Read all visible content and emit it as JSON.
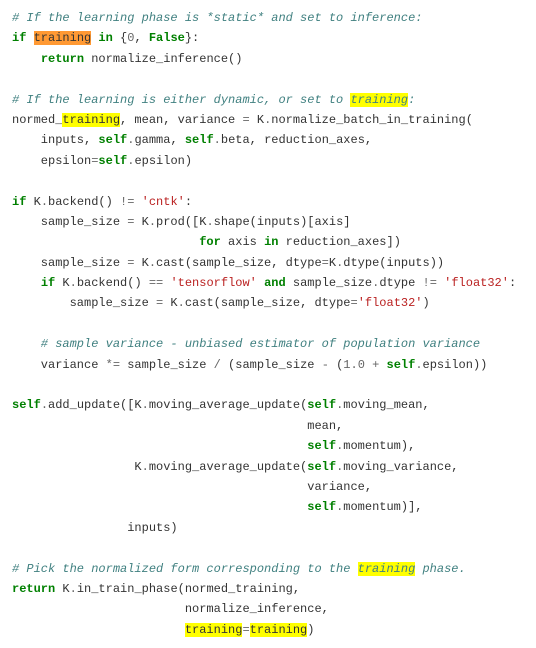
{
  "code": {
    "c1": "# If the learning phase is *static* and set to inference:",
    "l2_if": "if",
    "l2_training": "training",
    "l2_in": "in",
    "l2_brace_o": "{",
    "l2_zero": "0",
    "l2_comma": ", ",
    "l2_false": "False",
    "l2_brace_c": "}:",
    "l3_return": "return",
    "l3_normalize": " normalize_inference()",
    "c2a": "# If the learning is either dynamic, or set to ",
    "c2b": "training",
    "c2c": ":",
    "l5a": "normed_",
    "l5b": "training",
    "l5c": ", mean, variance ",
    "l5_eq": "=",
    "l5d": " K",
    "l5_dot": ".",
    "l5e": "normalize_batch_in_training(",
    "l6a": "    inputs, ",
    "l6_self1": "self",
    "l6_d1": ".",
    "l6_gamma": "gamma, ",
    "l6_self2": "self",
    "l6_d2": ".",
    "l6_beta": "beta, reduction_axes,",
    "l7_ep": "    epsilon",
    "l7_eq": "=",
    "l7_self": "self",
    "l7_d": ".",
    "l7_eps": "epsilon)",
    "l8_if": "if",
    "l8a": " K",
    "l8_d": ".",
    "l8b": "backend() ",
    "l8_ne": "!=",
    "l8_sp": " ",
    "l8_cntk": "'cntk'",
    "l8_col": ":",
    "l9a": "    sample_size ",
    "l9_eq": "=",
    "l9b": " K",
    "l9_d1": ".",
    "l9c": "prod([K",
    "l9_d2": ".",
    "l9d": "shape(inputs)[axis]",
    "l10_sp": "                          ",
    "l10_for": "for",
    "l10a": " axis ",
    "l10_in": "in",
    "l10b": " reduction_axes])",
    "l11a": "    sample_size ",
    "l11_eq": "=",
    "l11b": " K",
    "l11_d1": ".",
    "l11c": "cast(sample_size, dtype",
    "l11_eq2": "=",
    "l11d": "K",
    "l11_d2": ".",
    "l11e": "dtype(inputs))",
    "l12_sp": "    ",
    "l12_if": "if",
    "l12a": " K",
    "l12_d": ".",
    "l12b": "backend() ",
    "l12_eq": "==",
    "l12_sp2": " ",
    "l12_tf": "'tensorflow'",
    "l12_sp3": " ",
    "l12_and": "and",
    "l12c": " sample_size",
    "l12_d2": ".",
    "l12d": "dtype ",
    "l12_ne": "!=",
    "l12_sp4": " ",
    "l12_f32": "'float32'",
    "l12_col": ":",
    "l13a": "        sample_size ",
    "l13_eq": "=",
    "l13b": " K",
    "l13_d": ".",
    "l13c": "cast(sample_size, dtype",
    "l13_eq2": "=",
    "l13_f32": "'float32'",
    "l13_close": ")",
    "c3": "    # sample variance - unbiased estimator of population variance",
    "l14a": "    variance ",
    "l14_op": "*=",
    "l14b": " sample_size ",
    "l14_div": "/",
    "l14c": " (sample_size ",
    "l14_minus": "-",
    "l14d": " (",
    "l14_one": "1.0",
    "l14e": " ",
    "l14_plus": "+",
    "l14f": " ",
    "l14_self": "self",
    "l14_d": ".",
    "l14g": "epsilon))",
    "l15_self": "self",
    "l15_d": ".",
    "l15a": "add_update([K",
    "l15_d2": ".",
    "l15b": "moving_average_update(",
    "l15_self2": "self",
    "l15_d3": ".",
    "l15c": "moving_mean,",
    "l16_sp": "                                         ",
    "l16a": "mean,",
    "l17_sp": "                                         ",
    "l17_self": "self",
    "l17_d": ".",
    "l17a": "momentum),",
    "l18_sp": "                 ",
    "l18a": "K",
    "l18_d": ".",
    "l18b": "moving_average_update(",
    "l18_self": "self",
    "l18_d2": ".",
    "l18c": "moving_variance,",
    "l19_sp": "                                         ",
    "l19a": "variance,",
    "l20_sp": "                                         ",
    "l20_self": "self",
    "l20_d": ".",
    "l20a": "momentum)],",
    "l21_sp": "                ",
    "l21a": "inputs)",
    "c4a": "# Pick the normalized form corresponding to the ",
    "c4b": "training",
    "c4c": " phase.",
    "l22_ret": "return",
    "l22a": " K",
    "l22_d": ".",
    "l22b": "in_train_phase(normed_training,",
    "l23_sp": "                        ",
    "l23a": "normalize_inference,",
    "l24_sp": "                        ",
    "l24a": "training",
    "l24_eq": "=",
    "l24b": "training",
    "l24c": ")"
  }
}
